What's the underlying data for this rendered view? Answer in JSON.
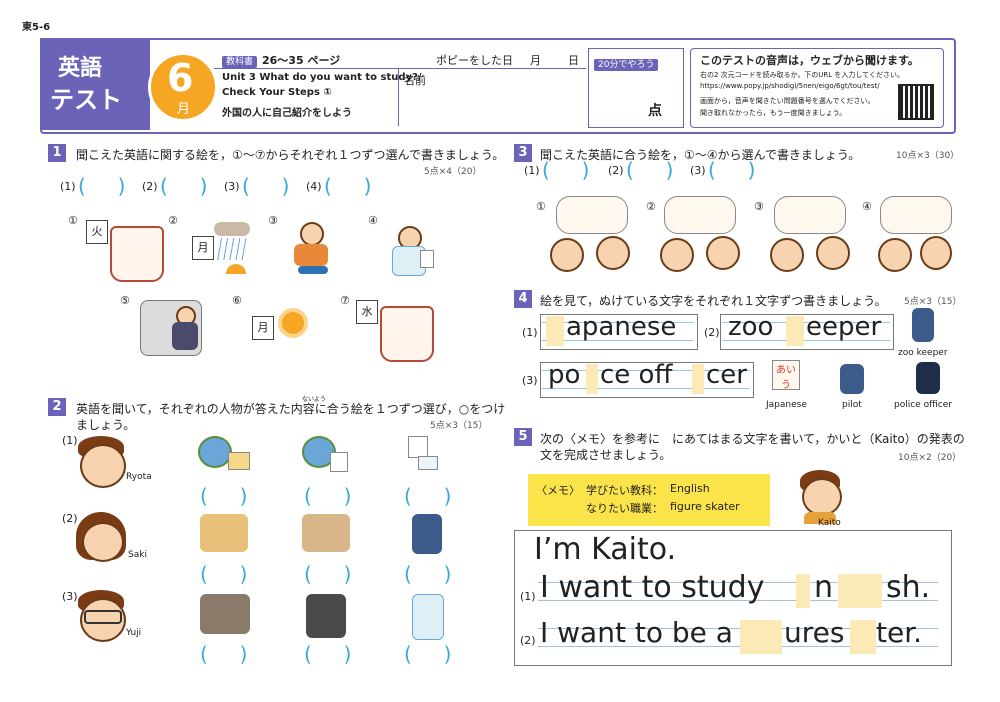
{
  "corner_label": "東5-6",
  "header": {
    "title_line1": "英語",
    "title_line2": "テスト",
    "grade": "6",
    "grade_suffix": "月",
    "textbook_badge": "教科書",
    "pages": "26〜35 ページ",
    "date_label": "ポピーをした日",
    "month": "月",
    "day": "日",
    "unit_line1": "Unit 3 What do you want to study?/",
    "unit_line2": "Check Your Steps ①",
    "unit_line3": "外国の人に自己紹介をしよう",
    "name_label": "名前",
    "time_badge": "20分でやろう",
    "score_label": "点",
    "audio_title": "このテストの音声は，ウェブから聞けます。",
    "audio_line1": "右の2 次元コードを読み取るか，下のURL を入力してください。",
    "audio_line2": "https://www.popy.jp/shodigi/5nen/eigo/6gt/tou/test/",
    "audio_line3": "画面から，音声を聞きたい問題番号を選んでください。",
    "audio_line4": "聞き取れなかったら，もう一度聞きましょう。"
  },
  "q1": {
    "num": "1",
    "text": "聞こえた英語に関する絵を，①〜⑦からそれぞれ１つずつ選んで書きましょう。",
    "points": "5点×4（20）",
    "blanks": [
      "(1)",
      "(2)",
      "(3)",
      "(4)"
    ],
    "pictures": [
      {
        "num": "①",
        "cal": "火"
      },
      {
        "num": "②",
        "cal": "月"
      },
      {
        "num": "③",
        "cal": ""
      },
      {
        "num": "④",
        "cal": ""
      },
      {
        "num": "⑤",
        "cal": ""
      },
      {
        "num": "⑥",
        "cal": "月"
      },
      {
        "num": "⑦",
        "cal": "水"
      }
    ]
  },
  "q2": {
    "num": "2",
    "text_line1": "英語を聞いて，それぞれの人物が答えた内容に合う絵を１つずつ選び，○をつけ",
    "text_line2": "ましょう。",
    "furigana": "ないよう",
    "points": "5点×3（15）",
    "people": [
      {
        "num": "(1)",
        "name": "Ryota"
      },
      {
        "num": "(2)",
        "name": "Saki"
      },
      {
        "num": "(3)",
        "name": "Yuji"
      }
    ]
  },
  "q3": {
    "num": "3",
    "text": "聞こえた英語に合う絵を，①〜④から選んで書きましょう。",
    "points": "10点×3（30）",
    "blanks": [
      "(1)",
      "(2)",
      "(3)"
    ],
    "pictures": [
      "①",
      "②",
      "③",
      "④"
    ]
  },
  "q4": {
    "num": "4",
    "text": "絵を見て，ぬけている文字をそれぞれ１文字ずつ書きましょう。",
    "points": "5点×3（15）",
    "items": [
      {
        "num": "(1)",
        "word": "apanese"
      },
      {
        "num": "(2)",
        "word_a": "zoo",
        "word_b": "eeper"
      },
      {
        "num": "(3)",
        "word_a": "po",
        "word_b": "ce off",
        "word_c": "cer"
      }
    ],
    "captions": [
      "zoo keeper",
      "Japanese",
      "pilot",
      "police officer"
    ]
  },
  "q5": {
    "num": "5",
    "text_line1": "次の〈メモ〉を参考に　にあてはまる文字を書いて，かいと（Kaito）の発表の",
    "text_line2": "文を完成させましょう。",
    "points": "10点×2（20）",
    "memo_label": "〈メモ〉",
    "memo_row1_label": "学びたい教科：",
    "memo_row1_value": "English",
    "memo_row2_label": "なりたい職業：",
    "memo_row2_value": "figure skater",
    "kaito_name": "Kaito",
    "sentence0": "I’m Kaito.",
    "line1_num": "(1)",
    "line1_a": "I want to study",
    "line1_b": "n",
    "line1_c": "sh.",
    "line2_num": "(2)",
    "line2_a": "I want to be a",
    "line2_b": "ures",
    "line2_c": "ter."
  }
}
